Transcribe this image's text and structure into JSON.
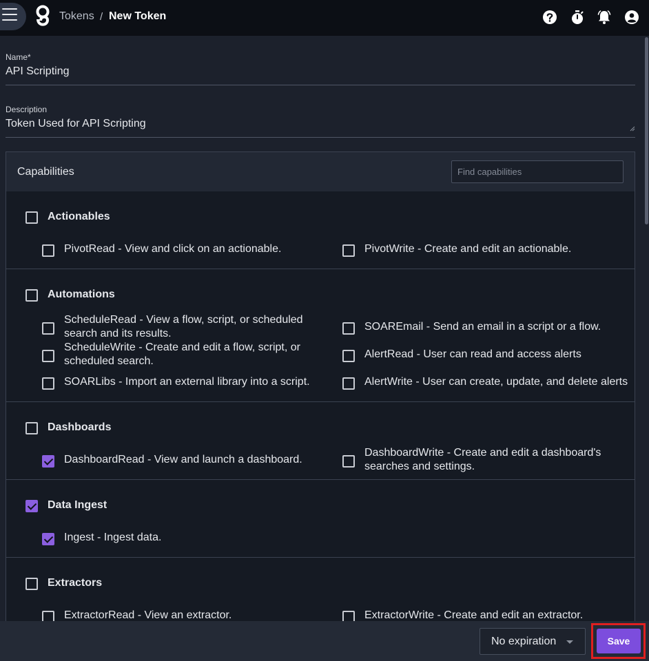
{
  "header": {
    "breadcrumb_parent": "Tokens",
    "breadcrumb_separator": "/",
    "breadcrumb_current": "New Token",
    "icons": [
      "menu-icon",
      "logo",
      "help-icon",
      "timer-icon",
      "notifications-icon",
      "account-icon"
    ]
  },
  "form": {
    "name_label": "Name*",
    "name_value": "API Scripting",
    "description_label": "Description",
    "description_value": "Token Used for API Scripting"
  },
  "capabilities": {
    "title": "Capabilities",
    "search_placeholder": "Find capabilities",
    "groups": [
      {
        "label": "Actionables",
        "checked": false,
        "items": [
          {
            "label": "PivotRead - View and click on an actionable.",
            "checked": false
          },
          {
            "label": "PivotWrite - Create and edit an actionable.",
            "checked": false
          }
        ]
      },
      {
        "label": "Automations",
        "checked": false,
        "items": [
          {
            "label": "ScheduleRead - View a flow, script, or scheduled search and its results.",
            "checked": false
          },
          {
            "label": "SOAREmail - Send an email in a script or a flow.",
            "checked": false
          },
          {
            "label": "ScheduleWrite - Create and edit a flow, script, or scheduled search.",
            "checked": false
          },
          {
            "label": "AlertRead - User can read and access alerts",
            "checked": false
          },
          {
            "label": "SOARLibs - Import an external library into a script.",
            "checked": false
          },
          {
            "label": "AlertWrite - User can create, update, and delete alerts",
            "checked": false
          }
        ]
      },
      {
        "label": "Dashboards",
        "checked": false,
        "items": [
          {
            "label": "DashboardRead - View and launch a dashboard.",
            "checked": true
          },
          {
            "label": "DashboardWrite - Create and edit a dashboard's searches and settings.",
            "checked": false
          }
        ]
      },
      {
        "label": "Data Ingest",
        "checked": true,
        "items": [
          {
            "label": "Ingest - Ingest data.",
            "checked": true
          }
        ]
      },
      {
        "label": "Extractors",
        "checked": false,
        "items": [
          {
            "label": "ExtractorRead - View an extractor.",
            "checked": false
          },
          {
            "label": "ExtractorWrite - Create and edit an extractor.",
            "checked": false
          }
        ]
      }
    ]
  },
  "footer": {
    "expiration_value": "No expiration",
    "save_label": "Save"
  },
  "colors": {
    "accent": "#7c4ddd",
    "checkbox_checked": "#8b5fe0",
    "highlight_outline": "#e02020"
  }
}
